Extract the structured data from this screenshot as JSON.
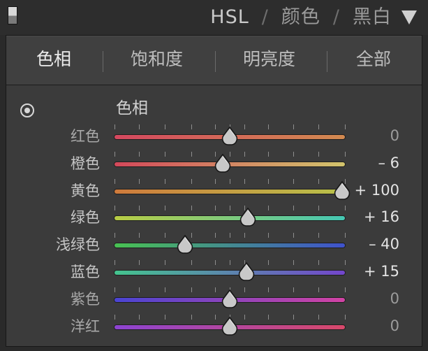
{
  "header": {
    "items": [
      "HSL",
      "颜色",
      "黑白"
    ],
    "separator": "/"
  },
  "tabs": [
    "色相",
    "饱和度",
    "明亮度",
    "全部"
  ],
  "section_title": "色相",
  "sliders": [
    {
      "label": "红色",
      "value_text": "0",
      "value": 0,
      "gradient": [
        "#d4485f",
        "#d28a50"
      ]
    },
    {
      "label": "橙色",
      "value_text": "– 6",
      "value": -6,
      "gradient": [
        "#d4485a",
        "#d2c46c"
      ]
    },
    {
      "label": "黄色",
      "value_text": "+ 100",
      "value": 100,
      "gradient": [
        "#cf7a3c",
        "#b8c24a"
      ]
    },
    {
      "label": "绿色",
      "value_text": "+ 16",
      "value": 16,
      "gradient": [
        "#b8cc44",
        "#45c8b4"
      ]
    },
    {
      "label": "浅绿色",
      "value_text": "– 40",
      "value": -40,
      "gradient": [
        "#48c252",
        "#3f52cc"
      ]
    },
    {
      "label": "蓝色",
      "value_text": "+ 15",
      "value": 15,
      "gradient": [
        "#44c48e",
        "#7346cc"
      ]
    },
    {
      "label": "紫色",
      "value_text": "0",
      "value": 0,
      "gradient": [
        "#4a44d2",
        "#d243a4"
      ]
    },
    {
      "label": "洋红",
      "value_text": "0",
      "value": 0,
      "gradient": [
        "#8d44d2",
        "#d8486a"
      ]
    }
  ],
  "slider_range": [
    -100,
    100
  ],
  "colors": {
    "panel_bg": "#3b3b3b",
    "header_bg": "#2d2d2d",
    "thumb": "#c8c8c8"
  }
}
